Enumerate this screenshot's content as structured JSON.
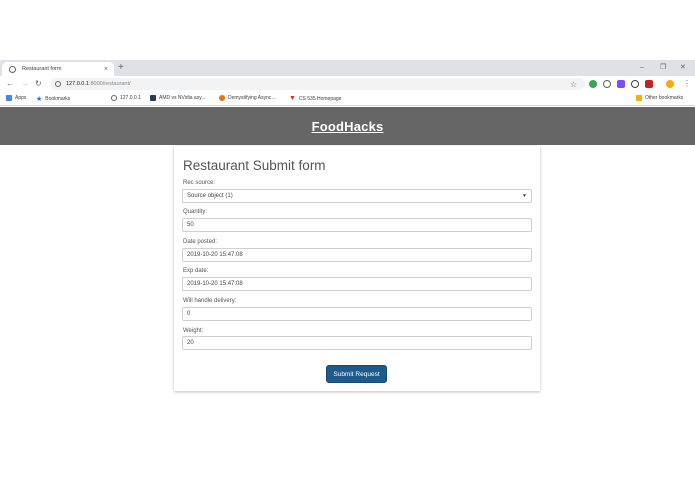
{
  "browser": {
    "tab_title": "Restaurant form",
    "tab_close": "×",
    "new_tab": "+",
    "window_controls": {
      "minimize": "–",
      "restore": "❐",
      "close": "✕"
    },
    "url_host": "127.0.0.1",
    "url_rest": ":8000/restaurant/",
    "bookmarks": [
      {
        "label": "Apps",
        "color": "#4285f4"
      },
      {
        "label": "Bookmarks",
        "color": "#1a73e8"
      },
      {
        "label": "127.0.0.1",
        "color": "#5f6368"
      },
      {
        "label": "AMD vs NVidia asy...",
        "color": "#2b3a55"
      },
      {
        "label": "Demystifying Async...",
        "color": "#e8710a"
      },
      {
        "label": "CS 535 Homepage",
        "color": "#d93025"
      }
    ],
    "other_bookmarks": "Other bookmarks"
  },
  "header": {
    "brand": "FoodHacks"
  },
  "form": {
    "title": "Restaurant Submit form",
    "rec_source_label": "Rec source:",
    "rec_source_value": "Source object (1)",
    "quantity_label": "Quantity:",
    "quantity_value": "50",
    "date_posted_label": "Date posted:",
    "date_posted_value": "2019-10-20 15:47:08",
    "exp_date_label": "Exp date:",
    "exp_date_value": "2019-10-20 15:47:08",
    "delivery_label": "Will handle delivery:",
    "delivery_value": "0",
    "weight_label": "Weight:",
    "weight_value": "20",
    "submit_label": "Submit Request"
  }
}
